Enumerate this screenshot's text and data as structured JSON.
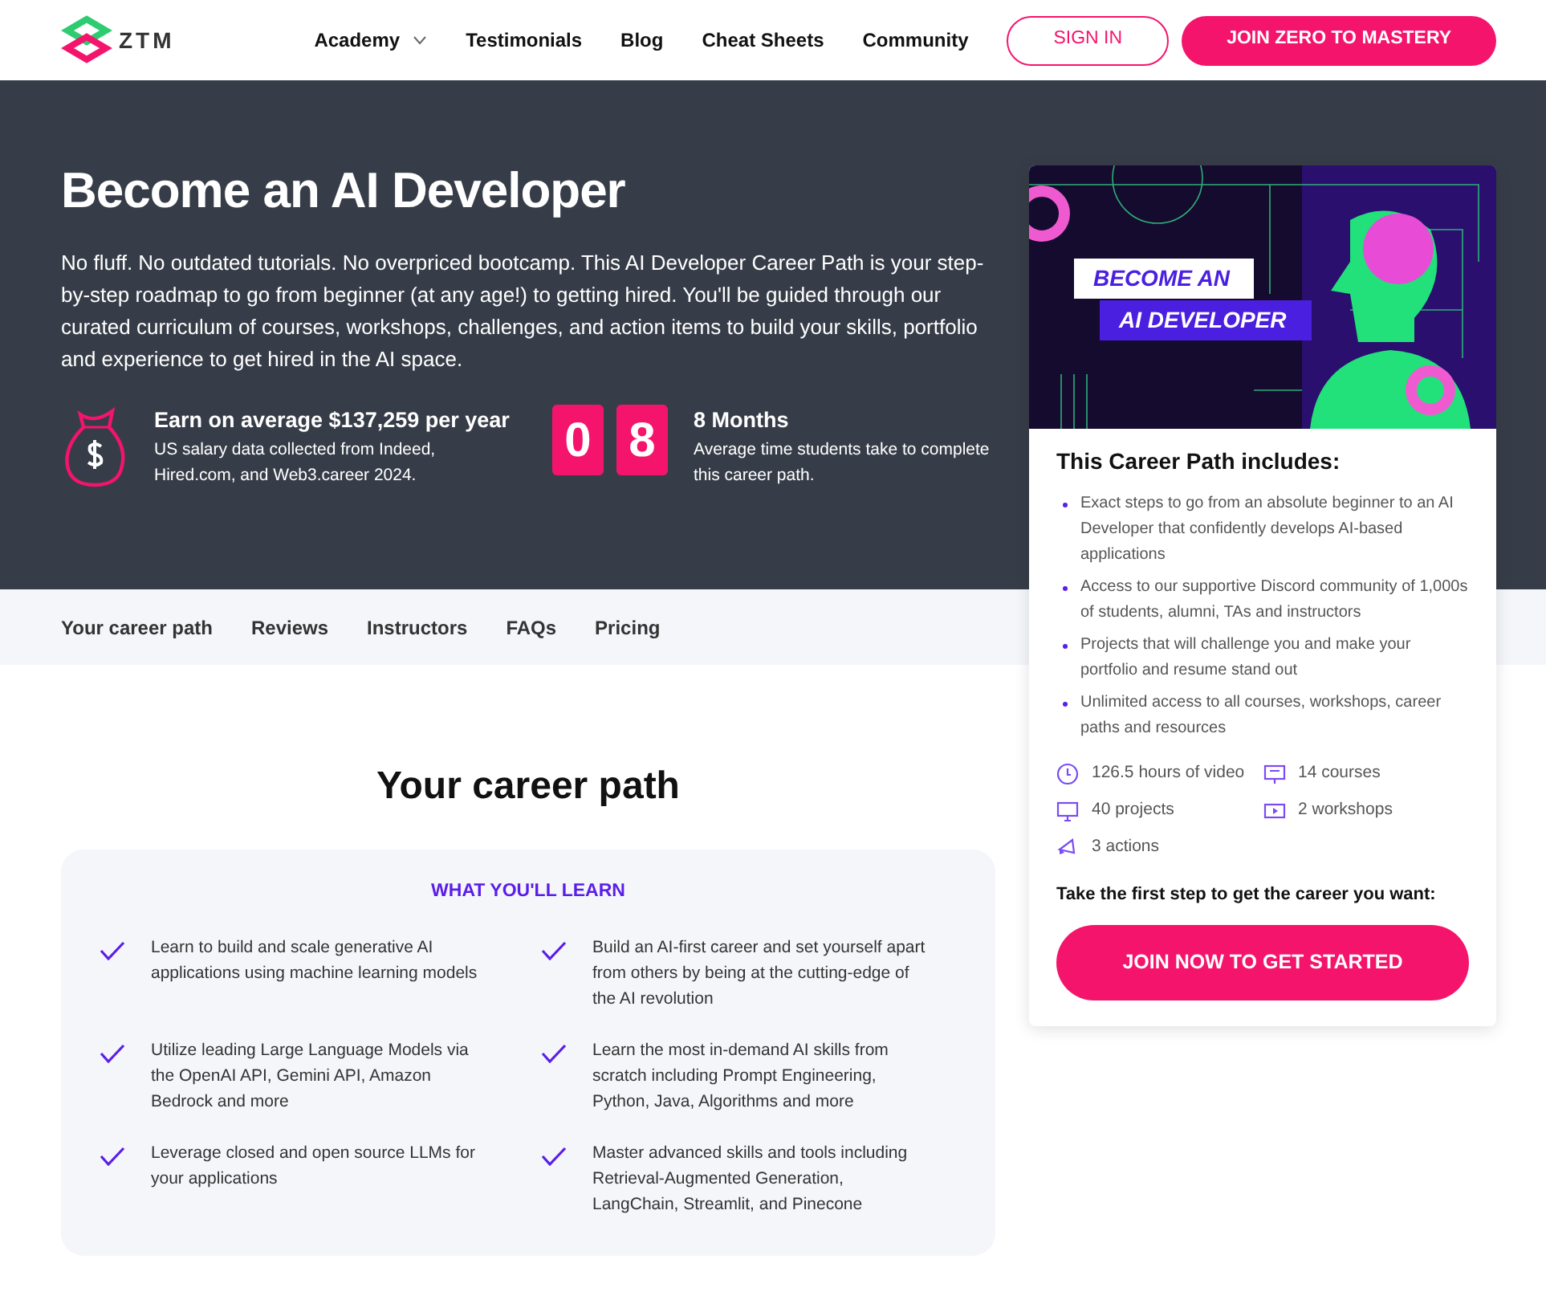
{
  "nav": {
    "logo": "ZTM",
    "links": [
      {
        "label": "Academy",
        "dropdown": true
      },
      {
        "label": "Testimonials",
        "dropdown": false
      },
      {
        "label": "Blog",
        "dropdown": false
      },
      {
        "label": "Cheat Sheets",
        "dropdown": false
      },
      {
        "label": "Community",
        "dropdown": false
      }
    ],
    "sign_in": "SIGN IN",
    "join": "JOIN ZERO TO MASTERY"
  },
  "hero": {
    "title": "Become an AI Developer",
    "description": "No fluff. No outdated tutorials. No overpriced bootcamp. This AI Developer Career Path is your step-by-step roadmap to go from beginner (at any age!) to getting hired. You'll be guided through our curated curriculum of courses, workshops, challenges, and action items to build your skills, portfolio and experience to get hired in the AI space.",
    "stats": [
      {
        "kind": "salary",
        "title": "Earn on average $137,259 per year",
        "text": "US salary data collected from Indeed, Hired.com, and Web3.career 2024."
      },
      {
        "kind": "flip",
        "digits": [
          "0",
          "8"
        ],
        "title": "8 Months",
        "text": "Average time students take to complete this career path."
      }
    ]
  },
  "section_nav": [
    {
      "label": "Your career path"
    },
    {
      "label": "Reviews"
    },
    {
      "label": "Instructors"
    },
    {
      "label": "FAQs"
    },
    {
      "label": "Pricing"
    }
  ],
  "sidebar": {
    "banner": {
      "lines": [
        "BECOME AN",
        "AI DEVELOPER"
      ]
    },
    "heading": "This Career Path includes:",
    "bullets": [
      "Exact steps to go from an absolute beginner to an AI Developer that confidently develops AI-based applications",
      "Access to our supportive Discord community of 1,000s of students, alumni, TAs and instructors",
      "Projects that will challenge you and make your portfolio and resume stand out",
      "Unlimited access to all courses, workshops, career paths and resources"
    ],
    "features": [
      {
        "kind": "clock",
        "label": "126.5 hours of video"
      },
      {
        "kind": "course",
        "label": "14 courses"
      },
      {
        "kind": "monitor",
        "label": "40 projects"
      },
      {
        "kind": "play",
        "label": "2 workshops"
      },
      {
        "kind": "megaphone",
        "label": "3 actions"
      }
    ],
    "cta_text": "Take the first step to get the career you want:",
    "button": "JOIN NOW TO GET STARTED"
  },
  "career_path": {
    "heading": "Your career path",
    "box_title": "WHAT YOU'LL LEARN",
    "items": [
      "Learn to build and scale generative AI applications using machine learning models",
      "Build an AI-first career and set yourself apart from others by being at the cutting-edge of the AI revolution",
      "Utilize leading Large Language Models via the OpenAI API, Gemini API, Amazon Bedrock and more",
      "Learn the most in-demand AI skills from scratch including Prompt Engineering, Python, Java, Algorithms and more",
      "Leverage closed and open source LLMs for your applications",
      "Master advanced skills and tools including Retrieval-Augmented Generation, LangChain, Streamlit, and Pinecone"
    ]
  }
}
